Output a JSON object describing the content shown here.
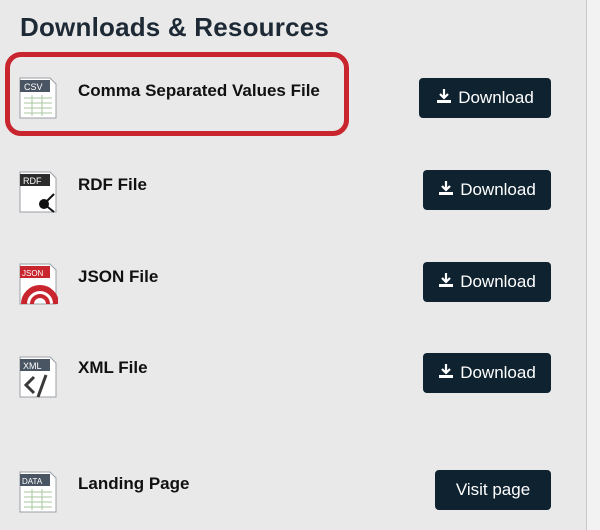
{
  "page": {
    "title": "Downloads & Resources"
  },
  "colors": {
    "button_bg": "#0f2230",
    "highlight": "#c8252e"
  },
  "resources": [
    {
      "label": "Comma Separated Values File",
      "icon": "csv-file-icon",
      "icon_text": "CSV",
      "button": "Download",
      "button_icon": "download-icon"
    },
    {
      "label": "RDF File",
      "icon": "rdf-file-icon",
      "icon_text": "RDF",
      "button": "Download",
      "button_icon": "download-icon"
    },
    {
      "label": "JSON File",
      "icon": "json-file-icon",
      "icon_text": "JSON",
      "button": "Download",
      "button_icon": "download-icon"
    },
    {
      "label": "XML File",
      "icon": "xml-file-icon",
      "icon_text": "XML",
      "button": "Download",
      "button_icon": "download-icon"
    },
    {
      "label": "Landing Page",
      "icon": "data-page-icon",
      "icon_text": "DATA",
      "button": "Visit page"
    }
  ]
}
